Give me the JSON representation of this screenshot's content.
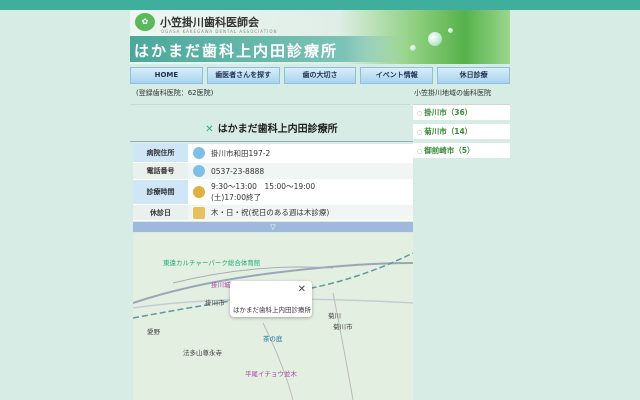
{
  "header": {
    "association": "小笠掛川歯科医師会",
    "association_en": "OGASA KAKEGAWA DENTAL ASSOCIATION",
    "clinic_banner": "はかまだ歯科上内田診療所"
  },
  "nav": [
    "HOME",
    "歯医者さんを探す",
    "歯の大切さ",
    "イベント情報",
    "休日診療"
  ],
  "registered": "(登録歯科医院：62医院)",
  "sidebar": {
    "title": "小笠掛川地域の歯科医院",
    "items": [
      "掛川市（36）",
      "菊川市（14）",
      "御前崎市（5）"
    ]
  },
  "clinic": {
    "name": "はかまだ歯科上内田診療所",
    "rows": [
      {
        "label": "病院住所",
        "value": "掛川市和田197-2",
        "icon": "map-pin-icon"
      },
      {
        "label": "電話番号",
        "value": "0537-23-8888",
        "icon": "phone-icon"
      },
      {
        "label": "診療時間",
        "value": "9:30〜13:00　15:00〜19:00",
        "value2": "(土)17:00終了",
        "icon": "clock-icon"
      },
      {
        "label": "休診日",
        "value": "木・日・祝(祝日のある週は木診療)",
        "icon": "calendar-icon"
      }
    ]
  },
  "toggle": "▽",
  "map": {
    "labels": [
      "東遠カルチャーパーク総合体育館",
      "掛川城",
      "掛川市",
      "菊川",
      "菊川市",
      "愛野",
      "法多山尊永寺",
      "茶の庭",
      "平尾イチョウ並木"
    ],
    "popup": "はかまだ歯科上内田診療所",
    "close": "✕"
  }
}
